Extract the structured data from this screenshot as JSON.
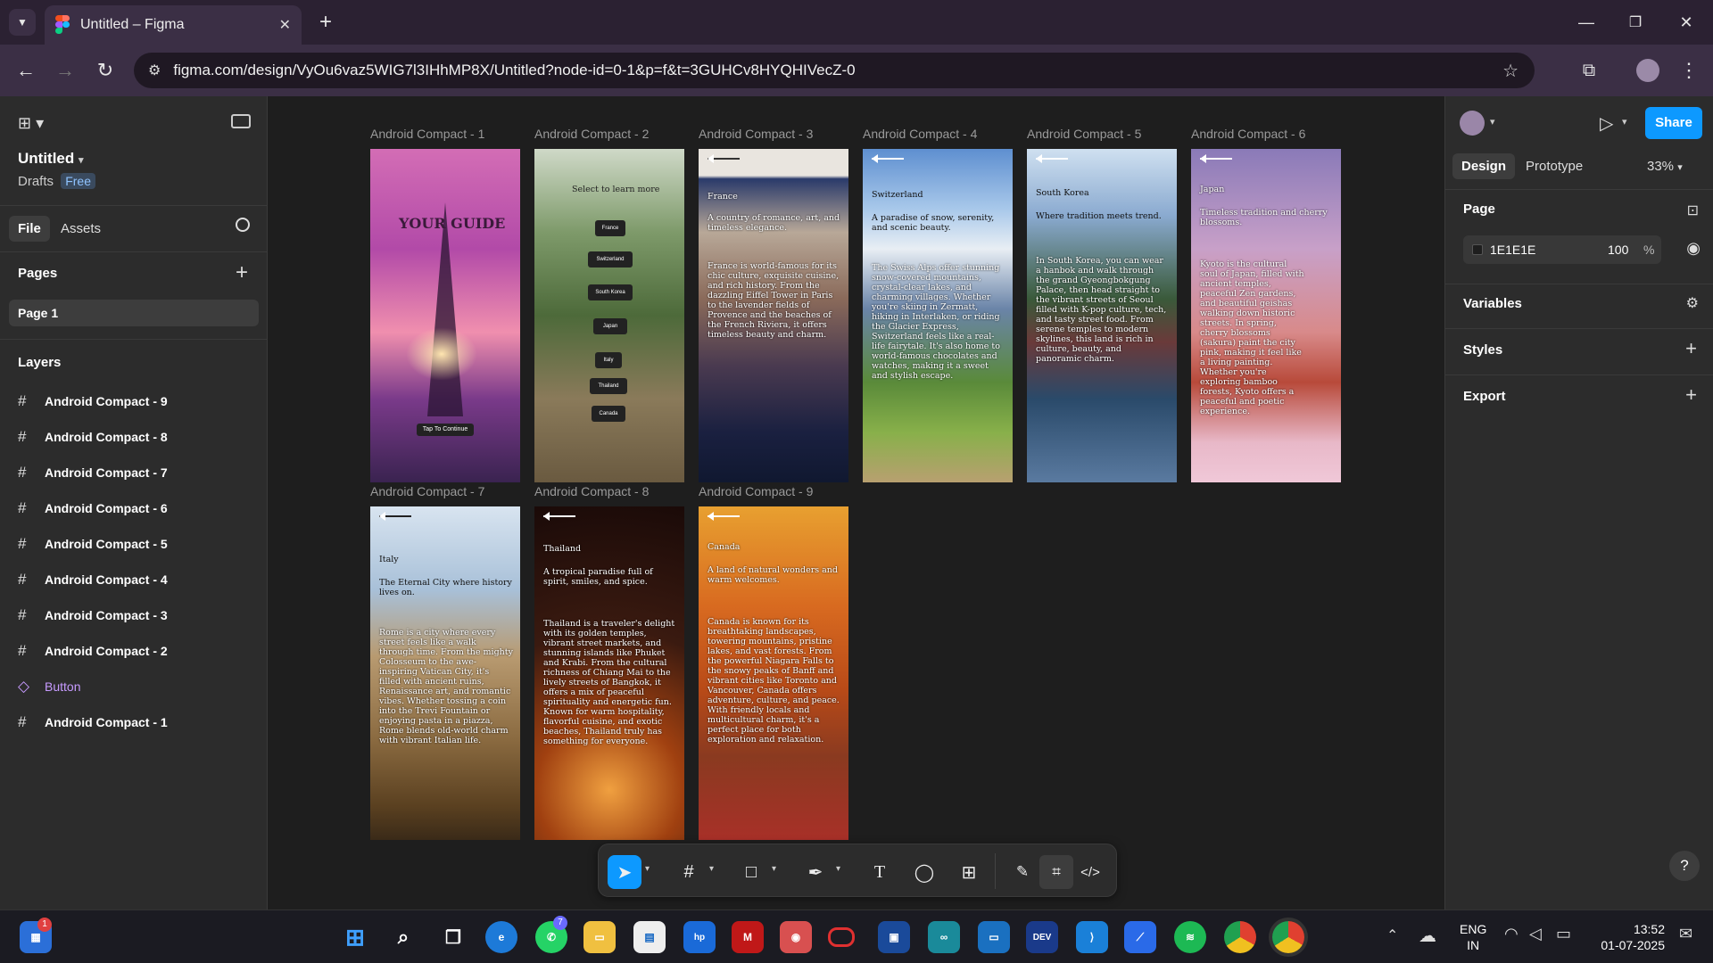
{
  "browser": {
    "tab_title": "Untitled – Figma",
    "url": "figma.com/design/VyOu6vaz5WIG7l3IHhMP8X/Untitled?node-id=0-1&p=f&t=3GUHCv8HYQHIVecZ-0"
  },
  "left_panel": {
    "file_name": "Untitled",
    "drafts": "Drafts",
    "plan_badge": "Free",
    "tabs": [
      "File",
      "Assets"
    ],
    "pages_heading": "Pages",
    "page_item": "Page 1",
    "layers_heading": "Layers",
    "layers": [
      "Android Compact - 9",
      "Android Compact - 8",
      "Android Compact - 7",
      "Android Compact - 6",
      "Android Compact - 5",
      "Android Compact - 4",
      "Android Compact - 3",
      "Android Compact - 2",
      "Button",
      "Android Compact - 1"
    ]
  },
  "canvas": {
    "frame_labels": [
      "Android Compact - 1",
      "Android Compact - 2",
      "Android Compact - 3",
      "Android Compact - 4",
      "Android Compact - 5",
      "Android Compact - 6",
      "Android Compact - 7",
      "Android Compact - 8",
      "Android Compact - 9"
    ],
    "f1": {
      "title": "YOUR GUIDE",
      "button": "Tap To Continue"
    },
    "f2": {
      "heading": "Select to learn more",
      "buttons": [
        "France",
        "Switzerland",
        "South Korea",
        "Japan",
        "Italy",
        "Thailand",
        "Canada"
      ]
    },
    "f3": {
      "country": "France",
      "tagline": "A country of romance, art, and timeless elegance.",
      "body": "France is world-famous for its chic culture, exquisite cuisine, and rich history. From the dazzling Eiffel Tower in Paris to the lavender fields of Provence and the beaches of the French Riviera, it offers timeless beauty and charm."
    },
    "f4": {
      "country": "Switzerland",
      "tagline": "A paradise of snow, serenity, and scenic beauty.",
      "body": "The Swiss Alps offer stunning snow-covered mountains, crystal-clear lakes, and charming villages. Whether you're skiing in Zermatt, hiking in Interlaken, or riding the Glacier Express, Switzerland feels like a real-life fairytale. It's also home to world-famous chocolates and watches, making it a sweet and stylish escape."
    },
    "f5": {
      "country": "South Korea",
      "tagline": "Where tradition meets trend.",
      "body": "In South Korea, you can wear a hanbok and walk through the grand Gyeongbokgung Palace, then head straight to the vibrant streets of Seoul filled with K-pop culture, tech, and tasty street food. From serene temples to modern skylines, this land is rich in culture, beauty, and panoramic charm."
    },
    "f6": {
      "country": "Japan",
      "tagline": "Timeless tradition and cherry blossoms.",
      "body": "Kyoto is the cultural soul of Japan, filled with ancient temples, peaceful Zen gardens, and beautiful geishas walking down historic streets. In spring, cherry blossoms (sakura) paint the city pink, making it feel like a living painting. Whether you're exploring bamboo forests, Kyoto offers a peaceful and poetic experience."
    },
    "f7": {
      "country": "Italy",
      "tagline": "The Eternal City where history lives on.",
      "body": "Rome is a city where every street feels like a walk through time. From the mighty Colosseum to the awe-inspiring Vatican City, it's filled with ancient ruins, Renaissance art, and romantic vibes. Whether tossing a coin into the Trevi Fountain or enjoying pasta in a piazza, Rome blends old-world charm with vibrant Italian life."
    },
    "f8": {
      "country": "Thailand",
      "tagline": "A tropical paradise full of spirit, smiles, and spice.",
      "body": "Thailand is a traveler's delight with its golden temples, vibrant street markets, and stunning islands like Phuket and Krabi. From the cultural richness of Chiang Mai to the lively streets of Bangkok, it offers a mix of peaceful spirituality and energetic fun. Known for warm hospitality, flavorful cuisine, and exotic beaches, Thailand truly has something for everyone."
    },
    "f9": {
      "country": "Canada",
      "tagline": "A land of natural wonders and warm welcomes.",
      "body": "Canada is known for its breathtaking landscapes, towering mountains, pristine lakes, and vast forests. From the powerful Niagara Falls to the snowy peaks of Banff and vibrant cities like Toronto and Vancouver, Canada offers adventure, culture, and peace. With friendly locals and multicultural charm, it's a perfect place for both exploration and relaxation."
    }
  },
  "right_panel": {
    "tabs": [
      "Design",
      "Prototype"
    ],
    "zoom": "33%",
    "share_label": "Share",
    "page_heading": "Page",
    "bg_hex": "1E1E1E",
    "bg_opacity": "100",
    "bg_pct": "%",
    "variables": "Variables",
    "styles": "Styles",
    "export": "Export",
    "help": "?"
  },
  "taskbar": {
    "lang": "ENG",
    "region": "IN",
    "time": "13:52",
    "date": "01-07-2025",
    "notif_count": "1",
    "whatsapp_badge": "7"
  }
}
